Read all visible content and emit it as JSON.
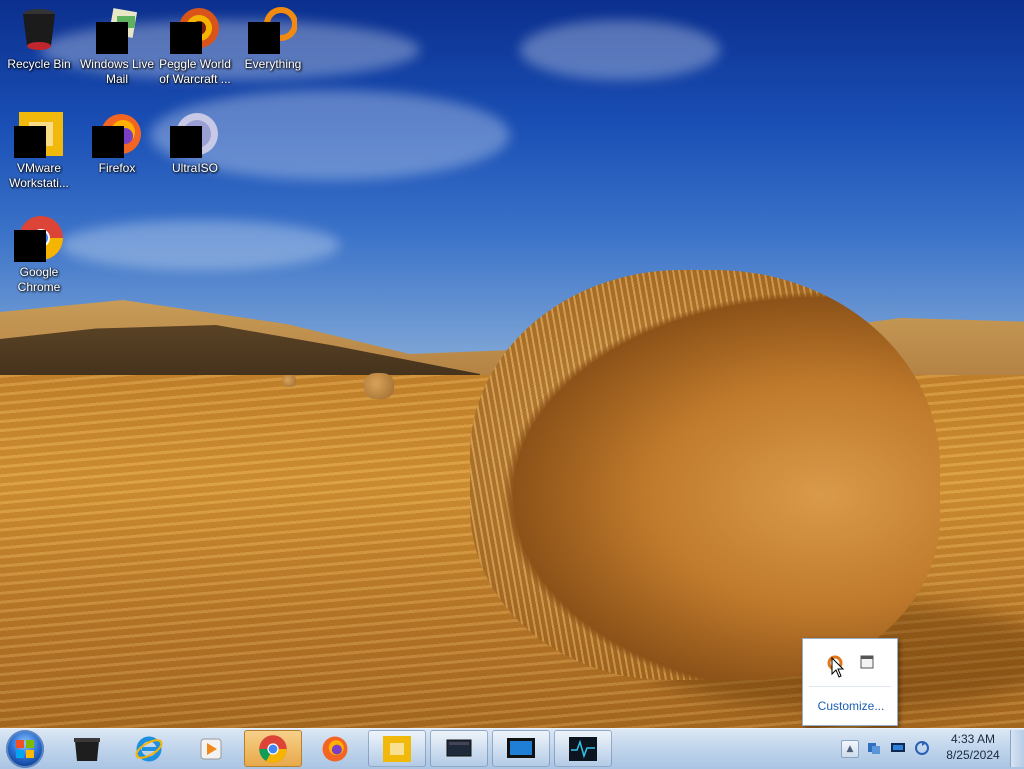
{
  "desktop": {
    "icons": [
      {
        "label": "Recycle Bin",
        "icon": "recycle-bin-icon"
      },
      {
        "label": "Windows Live Mail",
        "icon": "windows-live-mail-icon"
      },
      {
        "label": "Peggle World of Warcraft ...",
        "icon": "peggle-icon"
      },
      {
        "label": "Everything",
        "icon": "everything-icon"
      },
      {
        "label": "VMware Workstati...",
        "icon": "vmware-icon"
      },
      {
        "label": "Firefox",
        "icon": "firefox-icon"
      },
      {
        "label": "UltraISO",
        "icon": "ultraiso-icon"
      },
      {
        "label": "Google Chrome",
        "icon": "chrome-icon"
      }
    ]
  },
  "taskbar": {
    "start_icon": "windows-logo-icon",
    "buttons": [
      {
        "icon": "recycle-bin-icon"
      },
      {
        "icon": "internet-explorer-icon"
      },
      {
        "icon": "media-player-icon"
      },
      {
        "icon": "chrome-icon"
      },
      {
        "icon": "firefox-icon"
      },
      {
        "icon": "vmware-icon"
      },
      {
        "icon": "window-icon"
      },
      {
        "icon": "monitor-icon"
      },
      {
        "icon": "activity-monitor-icon"
      }
    ]
  },
  "tray": {
    "show_hidden_icon": "▲",
    "icons": [
      "network-icon",
      "display-icon",
      "sync-icon"
    ],
    "time": "4:33 AM",
    "date": "8/25/2024"
  },
  "tray_popup": {
    "icons": [
      "everything-icon",
      "window-icon"
    ],
    "customize_label": "Customize..."
  }
}
